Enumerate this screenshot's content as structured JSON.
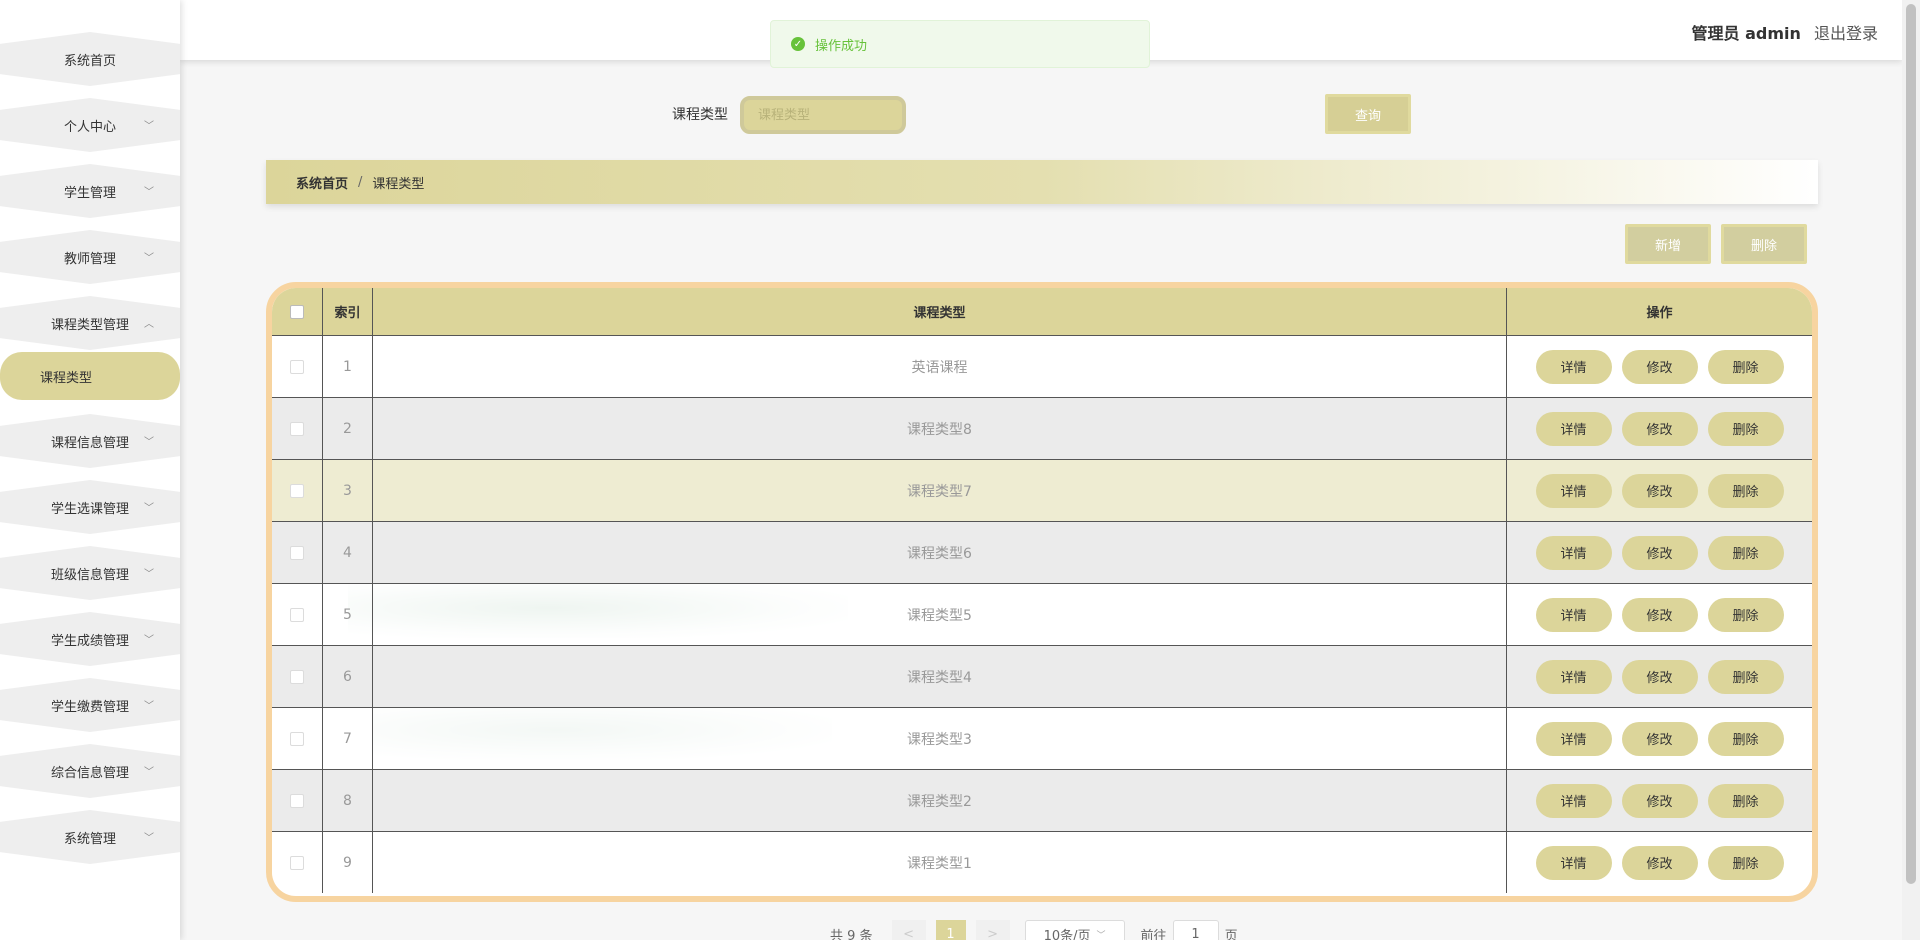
{
  "sidebar": {
    "items": [
      {
        "label": "系统首页",
        "chevron": ""
      },
      {
        "label": "个人中心",
        "chevron": "﹀"
      },
      {
        "label": "学生管理",
        "chevron": "﹀"
      },
      {
        "label": "教师管理",
        "chevron": "﹀"
      },
      {
        "label": "课程类型管理",
        "chevron": "︿"
      },
      {
        "label": "课程信息管理",
        "chevron": "﹀"
      },
      {
        "label": "学生选课管理",
        "chevron": "﹀"
      },
      {
        "label": "班级信息管理",
        "chevron": "﹀"
      },
      {
        "label": "学生成绩管理",
        "chevron": "﹀"
      },
      {
        "label": "学生缴费管理",
        "chevron": "﹀"
      },
      {
        "label": "综合信息管理",
        "chevron": "﹀"
      },
      {
        "label": "系统管理",
        "chevron": "﹀"
      }
    ],
    "active_sub": "课程类型"
  },
  "header": {
    "user_role": "管理员 admin",
    "logout": "退出登录"
  },
  "toast": {
    "message": "操作成功",
    "icon": "check-circle-icon",
    "color": "#67c23a"
  },
  "search": {
    "label": "课程类型",
    "placeholder": "课程类型",
    "button": "查询"
  },
  "breadcrumb": {
    "home": "系统首页",
    "separator": "/",
    "current": "课程类型"
  },
  "actions": {
    "add": "新增",
    "delete": "删除"
  },
  "table": {
    "headers": {
      "index": "索引",
      "name": "课程类型",
      "ops": "操作"
    },
    "rows": [
      {
        "index": "1",
        "name": "英语课程"
      },
      {
        "index": "2",
        "name": "课程类型8"
      },
      {
        "index": "3",
        "name": "课程类型7"
      },
      {
        "index": "4",
        "name": "课程类型6"
      },
      {
        "index": "5",
        "name": "课程类型5"
      },
      {
        "index": "6",
        "name": "课程类型4"
      },
      {
        "index": "7",
        "name": "课程类型3"
      },
      {
        "index": "8",
        "name": "课程类型2"
      },
      {
        "index": "9",
        "name": "课程类型1"
      }
    ],
    "op_labels": {
      "detail": "详情",
      "edit": "修改",
      "delete": "删除"
    }
  },
  "pagination": {
    "total": "共 9 条",
    "prev": "<",
    "current_page": "1",
    "next": ">",
    "page_size": "10条/页",
    "goto_label": "前往",
    "goto_value": "1",
    "page_suffix": "页"
  },
  "colors": {
    "accent": "#dcd59a",
    "table_border": "#f7d4a0",
    "success": "#67c23a"
  }
}
